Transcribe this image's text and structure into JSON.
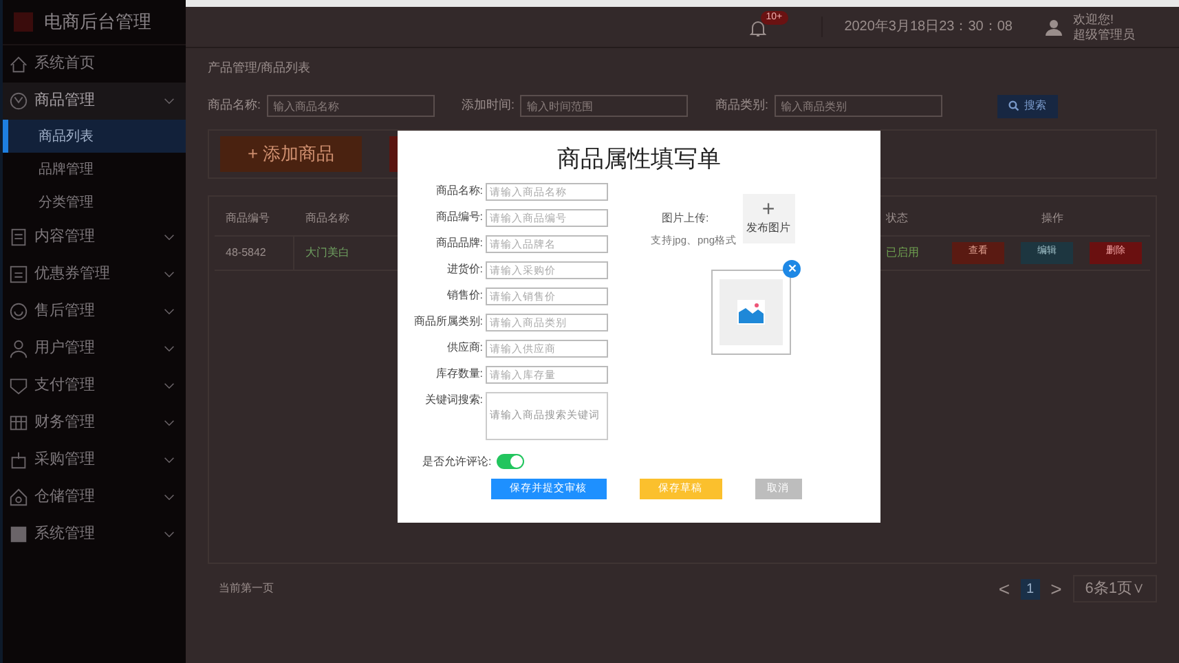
{
  "sidebar": {
    "title": "电商后台管理",
    "items": [
      {
        "label": "系统首页"
      },
      {
        "label": "商品管理",
        "expanded": true,
        "children": [
          {
            "label": "商品列表",
            "selected": true
          },
          {
            "label": "品牌管理",
            "selected": false
          },
          {
            "label": "分类管理",
            "selected": false
          }
        ]
      },
      {
        "label": "内容管理",
        "expanded": false
      },
      {
        "label": "优惠券管理",
        "expanded": false
      },
      {
        "label": "售后管理",
        "expanded": false
      },
      {
        "label": "用户管理",
        "expanded": false
      },
      {
        "label": "支付管理",
        "expanded": false
      },
      {
        "label": "财务管理",
        "expanded": false
      },
      {
        "label": "采购管理",
        "expanded": false
      },
      {
        "label": "仓储管理",
        "expanded": false
      },
      {
        "label": "系统管理",
        "expanded": false
      }
    ]
  },
  "header": {
    "badge": "10+",
    "datetime": "2020年3月18日23：30：08",
    "greeting": "欢迎您!",
    "user": "超级管理员"
  },
  "breadcrumb": "产品管理/商品列表",
  "filters": [
    {
      "label": "商品名称:",
      "placeholder": "输入商品名称"
    },
    {
      "label": "添加时间:",
      "placeholder": "输入时间范围"
    },
    {
      "label": "商品类别:",
      "placeholder": "输入商品类别"
    }
  ],
  "search_button": "搜索",
  "add_button": "+ 添加商品",
  "table": {
    "columns": [
      "商品编号",
      "商品名称",
      "状态",
      "操作"
    ],
    "rows": [
      {
        "id": "48-5842",
        "name": "大门美白",
        "status": "已启用",
        "actions": [
          "查看",
          "编辑",
          "删除"
        ]
      }
    ]
  },
  "footer": {
    "page_text": "当前第一页",
    "prev": "<",
    "current_page": "1",
    "next": ">",
    "page_size": "6条1页∨"
  },
  "dialog": {
    "title": "商品属性填写单",
    "fields": [
      {
        "kind": "input",
        "label": "商品名称:",
        "placeholder": "请输入商品名称"
      },
      {
        "kind": "input",
        "label": "商品编号:",
        "placeholder": "请输入商品编号"
      },
      {
        "kind": "input",
        "label": "商品品牌:",
        "placeholder": "请输入品牌名"
      },
      {
        "kind": "input",
        "label": "进货价:",
        "placeholder": "请输入采购价"
      },
      {
        "kind": "input",
        "label": "销售价:",
        "placeholder": "请输入销售价"
      },
      {
        "kind": "input",
        "label": "商品所属类别:",
        "placeholder": "请输入商品类别"
      },
      {
        "kind": "input",
        "label": "供应商:",
        "placeholder": "请输入供应商"
      },
      {
        "kind": "input",
        "label": "库存数量:",
        "placeholder": "请输入库存量"
      },
      {
        "kind": "textarea",
        "label": "关键词搜索:",
        "placeholder": "请输入商品搜索关键词"
      }
    ],
    "upload_label": "图片上传:",
    "upload_plus": "+",
    "upload_button": "发布图片",
    "upload_hint": "支持jpg、png格式",
    "comments": {
      "label": "是否允许评论:",
      "on": true
    },
    "buttons": [
      {
        "kind": "primary",
        "label": "保存并提交审核"
      },
      {
        "kind": "warning",
        "label": "保存草稿"
      },
      {
        "kind": "cancel",
        "label": "取消"
      }
    ]
  }
}
